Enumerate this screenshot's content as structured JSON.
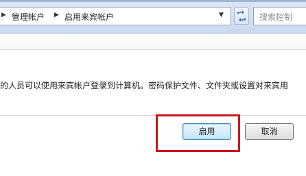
{
  "address_bar": {
    "breadcrumb": [
      "管理帐户",
      "启用来宾帐户"
    ],
    "search_placeholder": "搜索控制"
  },
  "content": {
    "description": "的人员可以使用来宾帐户登录到计算机。密码保护文件、文件夹或设置对来宾用"
  },
  "buttons": {
    "enable_label": "启用",
    "cancel_label": "取消"
  },
  "highlight": {
    "color": "#c8161d",
    "target": "enable-button"
  }
}
